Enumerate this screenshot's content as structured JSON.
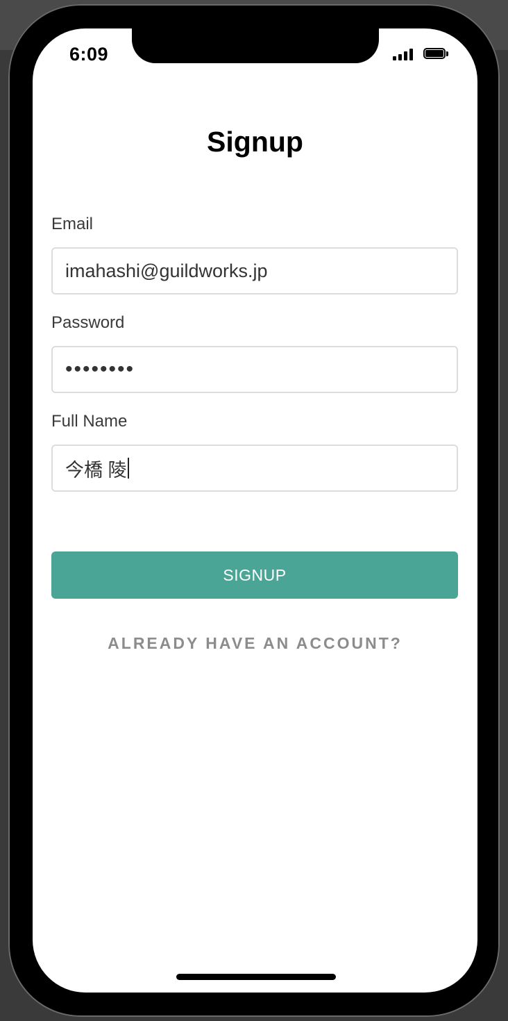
{
  "status_bar": {
    "time": "6:09",
    "signal_icon": "cellular-signal-icon",
    "battery_icon": "battery-icon"
  },
  "page": {
    "title": "Signup"
  },
  "form": {
    "email_label": "Email",
    "email_value": "imahashi@guildworks.jp",
    "password_label": "Password",
    "password_value": "••••••••",
    "full_name_label": "Full Name",
    "full_name_value": "今橋 陵"
  },
  "actions": {
    "signup_label": "SIGNUP",
    "login_link_label": "ALREADY HAVE AN ACCOUNT?"
  },
  "colors": {
    "accent": "#4aa597",
    "link": "#8c8c8c"
  }
}
